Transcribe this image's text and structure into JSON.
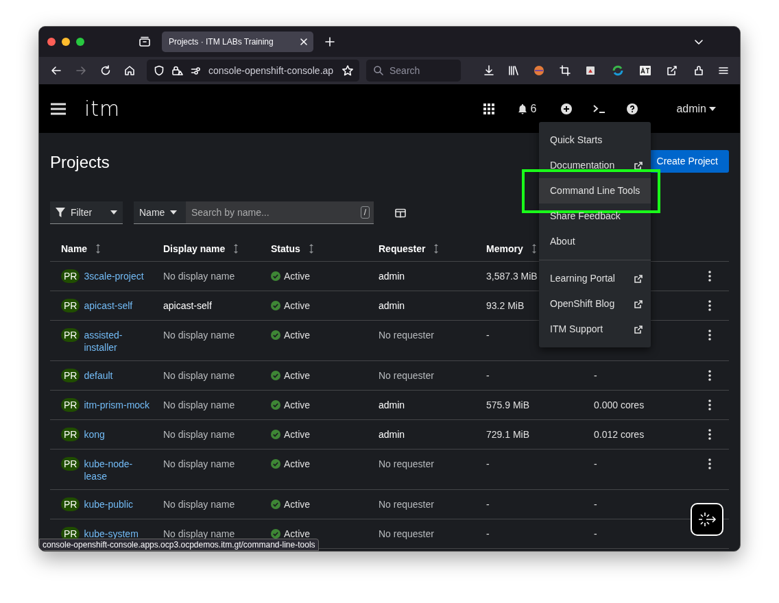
{
  "browser": {
    "tabs": [
      {
        "title": "Projects · ITM LABs Training",
        "selected": true
      }
    ],
    "url": "console-openshift-console.ap",
    "search_placeholder": "Search"
  },
  "masthead": {
    "logo": "itm",
    "notification_count": "6",
    "user": "admin"
  },
  "help_menu": {
    "groups": [
      [
        {
          "label": "Quick Starts",
          "external": false,
          "hovered": false
        },
        {
          "label": "Documentation",
          "external": true,
          "hovered": false
        },
        {
          "label": "Command Line Tools",
          "external": false,
          "hovered": true
        },
        {
          "label": "Share Feedback",
          "external": false,
          "hovered": false
        },
        {
          "label": "About",
          "external": false,
          "hovered": false
        }
      ],
      [
        {
          "label": "Learning Portal",
          "external": true,
          "hovered": false
        },
        {
          "label": "OpenShift Blog",
          "external": true,
          "hovered": false
        },
        {
          "label": "ITM Support",
          "external": true,
          "hovered": false
        }
      ]
    ],
    "annotation": {
      "kind": "frame"
    }
  },
  "page": {
    "title": "Projects",
    "create_button": "Create Project"
  },
  "toolbar": {
    "filter": "Filter",
    "attribute": "Name",
    "search_placeholder": "Search by name...",
    "shortcut": "/"
  },
  "table": {
    "columns": [
      {
        "label": "Name"
      },
      {
        "label": "Display name"
      },
      {
        "label": "Status"
      },
      {
        "label": "Requester"
      },
      {
        "label": "Memory"
      }
    ],
    "rows": [
      {
        "badge": "PR",
        "name": "3scale-project",
        "display_name": "No display name",
        "display_name_missing": true,
        "status": "Active",
        "requester": "admin",
        "requester_missing": false,
        "memory": "3,587.3 MiB"
      },
      {
        "badge": "PR",
        "name": "apicast-self",
        "display_name": "apicast-self",
        "display_name_missing": false,
        "status": "Active",
        "requester": "admin",
        "requester_missing": false,
        "memory": "93.2 MiB"
      },
      {
        "badge": "PR",
        "name": "assisted-installer",
        "display_name": "No display name",
        "display_name_missing": true,
        "status": "Active",
        "requester": "No requester",
        "requester_missing": true,
        "memory": "-"
      },
      {
        "badge": "PR",
        "name": "default",
        "display_name": "No display name",
        "display_name_missing": true,
        "status": "Active",
        "requester": "No requester",
        "requester_missing": true,
        "memory": "-",
        "cpu": "-"
      },
      {
        "badge": "PR",
        "name": "itm-prism-mock",
        "display_name": "No display name",
        "display_name_missing": true,
        "status": "Active",
        "requester": "admin",
        "requester_missing": false,
        "memory": "575.9 MiB",
        "cpu": "0.000 cores"
      },
      {
        "badge": "PR",
        "name": "kong",
        "display_name": "No display name",
        "display_name_missing": true,
        "status": "Active",
        "requester": "admin",
        "requester_missing": false,
        "memory": "729.1 MiB",
        "cpu": "0.012 cores"
      },
      {
        "badge": "PR",
        "name": "kube-node-lease",
        "display_name": "No display name",
        "display_name_missing": true,
        "status": "Active",
        "requester": "No requester",
        "requester_missing": true,
        "memory": "-",
        "cpu": "-"
      },
      {
        "badge": "PR",
        "name": "kube-public",
        "display_name": "No display name",
        "display_name_missing": true,
        "status": "Active",
        "requester": "No requester",
        "requester_missing": true,
        "memory": "-",
        "cpu": "-"
      },
      {
        "badge": "PR",
        "name": "kube-system",
        "display_name": "No display name",
        "display_name_missing": true,
        "status": "Active",
        "requester": "No requester",
        "requester_missing": true,
        "memory": "-",
        "cpu": "-"
      }
    ]
  },
  "status_bar": {
    "url": "console-openshift-console.apps.ocp3.ocpdemos.itm.gt/command-line-tools"
  }
}
